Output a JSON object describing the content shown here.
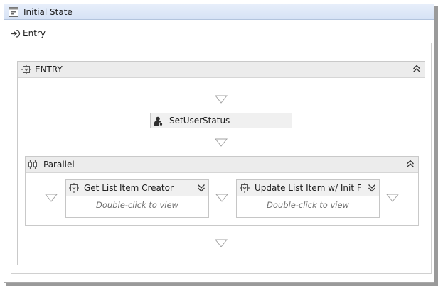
{
  "state": {
    "title": "Initial State",
    "entry_label": "Entry",
    "entry_sequence": {
      "title": "ENTRY",
      "activity": {
        "label": "SetUserStatus"
      },
      "parallel": {
        "title": "Parallel",
        "branches": [
          {
            "title": "Get List Item Creator",
            "hint": "Double-click to view"
          },
          {
            "title": "Update List Item w/ Init For",
            "hint": "Double-click to view"
          }
        ]
      }
    }
  },
  "icons": {
    "state": "state-window-icon",
    "entry": "entry-arrow-icon",
    "sequence": "sequence-icon",
    "user": "user-activity-icon",
    "parallel": "parallel-icon",
    "collapse": "collapse-up-icon",
    "expand": "expand-down-icon",
    "drop": "drop-target-arrow-icon"
  },
  "colors": {
    "header_blue": "#dbe6f7",
    "bar_gray": "#ececec",
    "hint_gray": "#707070",
    "arrow_gray": "#a0a0a0"
  }
}
